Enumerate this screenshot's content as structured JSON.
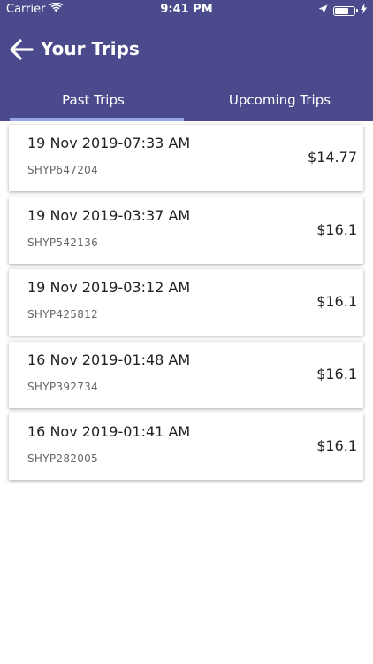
{
  "status_bar": {
    "carrier": "Carrier",
    "time": "9:41 PM",
    "battery_level": 0.75
  },
  "nav": {
    "title": "Your Trips"
  },
  "tabs": [
    {
      "label": "Past Trips",
      "active": true
    },
    {
      "label": "Upcoming Trips",
      "active": false
    }
  ],
  "trips": [
    {
      "datetime": "19 Nov 2019-07:33 AM",
      "booking_id": "SHYP647204",
      "fare": "$14.77"
    },
    {
      "datetime": "19 Nov 2019-03:37 AM",
      "booking_id": "SHYP542136",
      "fare": "$16.1"
    },
    {
      "datetime": "19 Nov 2019-03:12 AM",
      "booking_id": "SHYP425812",
      "fare": "$16.1"
    },
    {
      "datetime": "16 Nov 2019-01:48 AM",
      "booking_id": "SHYP392734",
      "fare": "$16.1"
    },
    {
      "datetime": "16 Nov 2019-01:41 AM",
      "booking_id": "SHYP282005",
      "fare": "$16.1"
    }
  ],
  "colors": {
    "header": "#4a4a8c",
    "tab_indicator": "#9aa2e8"
  }
}
